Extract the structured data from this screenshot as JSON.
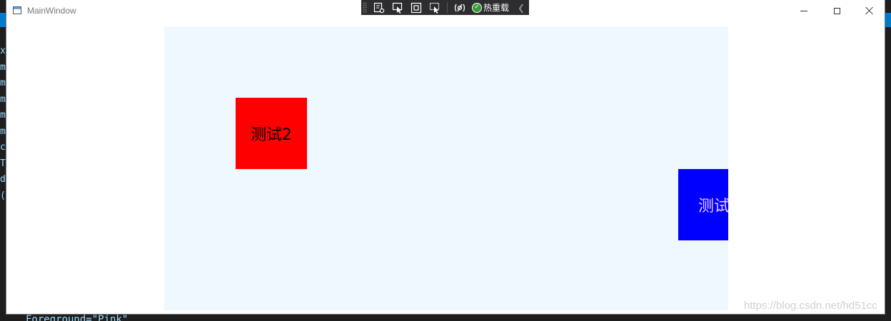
{
  "window": {
    "title": "MainWindow"
  },
  "debug_toolbar": {
    "items": [
      {
        "icon": "live-visual-tree-icon"
      },
      {
        "icon": "select-element-icon"
      },
      {
        "icon": "display-adorners-icon"
      },
      {
        "icon": "track-focus-icon"
      },
      {
        "icon": "binding-failures-icon"
      }
    ],
    "hot_reload_label": "热重载"
  },
  "canvas": {
    "background": "#f0f8ff",
    "elements": [
      {
        "label": "测试2",
        "background": "#ff0000",
        "text_color": "#000000"
      },
      {
        "label": "测试",
        "background": "#0000ff",
        "text_color": "#e8c8ff"
      }
    ]
  },
  "watermark": "https://blog.csdn.net/hd51cc",
  "background_code": {
    "gutter_chars": [
      "x",
      "m",
      "m",
      "m",
      "m",
      "m",
      "c",
      "T",
      "d",
      "("
    ],
    "bottom_line": "Foreground=\"Pink\""
  }
}
